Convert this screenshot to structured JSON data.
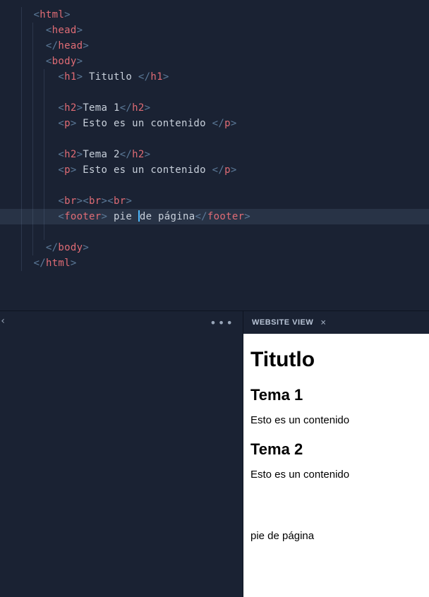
{
  "editor": {
    "lines": [
      {
        "indent": 1,
        "type": "open",
        "tag": "html"
      },
      {
        "indent": 2,
        "type": "open",
        "tag": "head"
      },
      {
        "indent": 2,
        "type": "close",
        "tag": "head"
      },
      {
        "indent": 2,
        "type": "open",
        "tag": "body"
      },
      {
        "indent": 3,
        "type": "pair",
        "tag": "h1",
        "text": " Titutlo "
      },
      {
        "indent": 3,
        "type": "blank"
      },
      {
        "indent": 3,
        "type": "pair",
        "tag": "h2",
        "text": "Tema 1"
      },
      {
        "indent": 3,
        "type": "pair",
        "tag": "p",
        "text": " Esto es un contenido "
      },
      {
        "indent": 3,
        "type": "blank"
      },
      {
        "indent": 3,
        "type": "pair",
        "tag": "h2",
        "text": "Tema 2"
      },
      {
        "indent": 3,
        "type": "pair",
        "tag": "p",
        "text": " Esto es un contenido "
      },
      {
        "indent": 3,
        "type": "blank"
      },
      {
        "indent": 3,
        "type": "triple-br"
      },
      {
        "indent": 3,
        "type": "pair",
        "tag": "footer",
        "text": " pie de página",
        "highlighted": true,
        "cursorAfter": " pie "
      },
      {
        "indent": 3,
        "type": "blank"
      },
      {
        "indent": 2,
        "type": "close",
        "tag": "body"
      },
      {
        "indent": 1,
        "type": "close",
        "tag": "html"
      }
    ]
  },
  "bottomLeft": {
    "chevron": "‹",
    "more": "•••"
  },
  "websiteView": {
    "tabTitle": "WEBSITE VIEW",
    "closeIcon": "×",
    "h1": "Titutlo",
    "h2_1": "Tema 1",
    "p1": "Esto es un contenido",
    "h2_2": "Tema 2",
    "p2": "Esto es un contenido",
    "footer": "pie de página"
  }
}
